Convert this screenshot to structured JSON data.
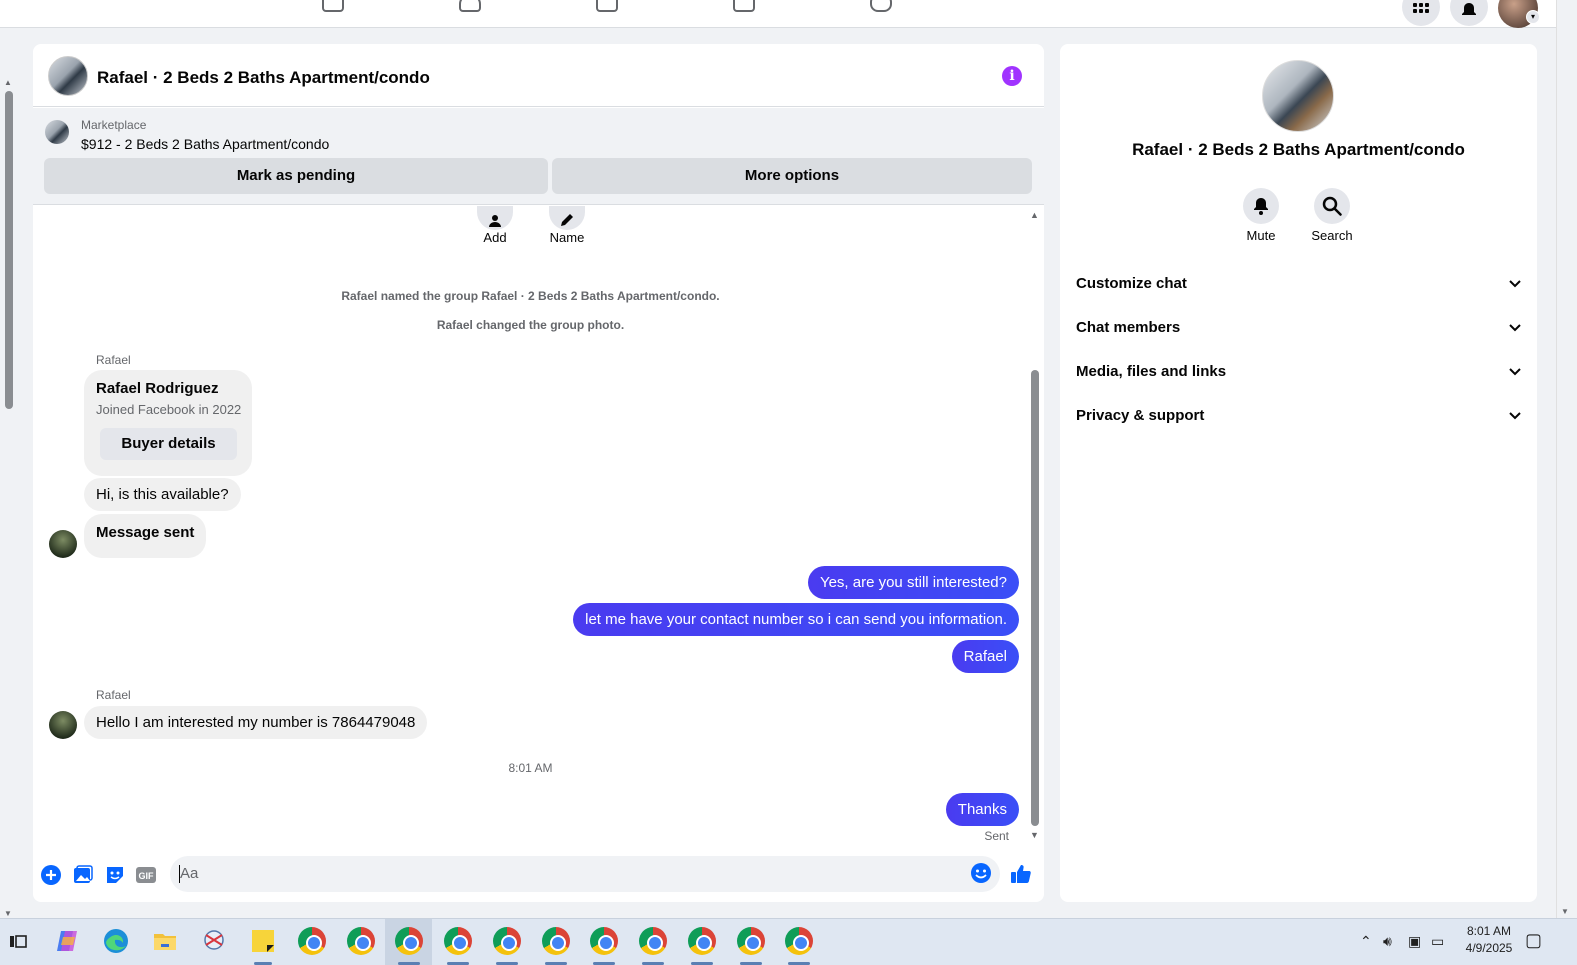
{
  "chat": {
    "title": "Rafael · 2 Beds 2 Baths Apartment/condo",
    "marketplace_label": "Marketplace",
    "listing": "$912 - 2 Beds 2 Baths Apartment/condo",
    "mark_pending": "Mark as pending",
    "more_options": "More options",
    "add_label": "Add",
    "name_label": "Name",
    "system_messages": [
      "Rafael named the group Rafael · 2 Beds 2 Baths Apartment/condo.",
      "Rafael changed the group photo."
    ],
    "sender_name": "Rafael",
    "card_name": "Rafael Rodriguez",
    "card_sub": "Joined Facebook in 2022",
    "card_button": "Buyer details",
    "msg_in_1": "Hi, is this available?",
    "msg_in_2": "Message sent",
    "msg_out_1": "Yes, are you still interested?",
    "msg_out_2": "let me have your contact number so i can send you information.",
    "msg_out_3": "Rafael",
    "msg_in_3": "Hello I am interested my number is 7864479048",
    "timestamp": "8:01 AM",
    "msg_out_4": "Thanks",
    "sent_status": "Sent",
    "input_placeholder": "Aa"
  },
  "info": {
    "title": "Rafael · 2 Beds 2 Baths Apartment/condo",
    "mute_label": "Mute",
    "search_label": "Search",
    "sections": [
      "Customize chat",
      "Chat members",
      "Media, files and links",
      "Privacy & support"
    ]
  },
  "taskbar": {
    "time": "8:01 AM",
    "date": "4/9/2025"
  },
  "colors": {
    "accent": "#3b4ff5",
    "info_icon": "#a033ff",
    "composer_icons": "#0866ff"
  }
}
